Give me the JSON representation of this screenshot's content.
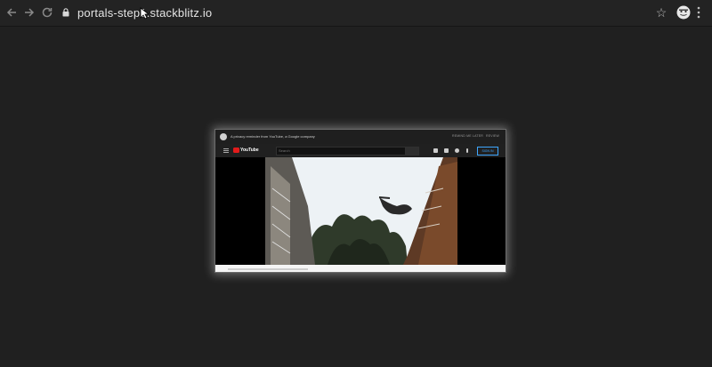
{
  "browser": {
    "url": "portals-step1.stackblitz.io",
    "nav": {
      "back_icon": "arrow-left-icon",
      "forward_icon": "arrow-right-icon",
      "reload_icon": "reload-icon"
    }
  },
  "portal": {
    "banner": {
      "text": "A privacy reminder from YouTube, a Google company",
      "remind_label": "REMIND ME LATER",
      "review_label": "REVIEW"
    },
    "header": {
      "logo_text": "YouTube",
      "search_placeholder": "Search",
      "signin_label": "SIGN IN"
    }
  },
  "colors": {
    "page_background": "#202020",
    "toolbar": "#232323",
    "youtube_red": "#e21b1b",
    "signin_blue": "#3ea6ff"
  }
}
